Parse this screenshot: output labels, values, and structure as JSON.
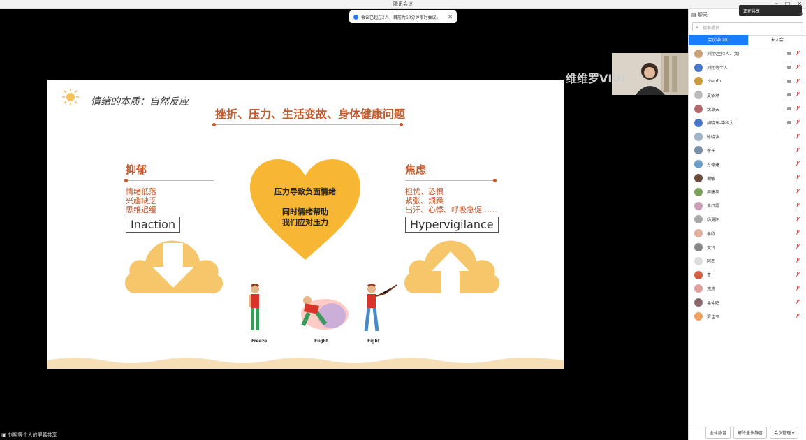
{
  "window": {
    "title": "腾讯会议",
    "controls": [
      "–",
      "□",
      "✕"
    ]
  },
  "notice": {
    "text": "会议已超过2人，目前为60分钟限时会议。",
    "close": "✕"
  },
  "slide": {
    "title": "情绪的本质：自然反应",
    "headline": "挫折、压力、生活变故、身体健康问题",
    "left": {
      "title": "抑郁",
      "items": [
        "情绪低落",
        "兴趣缺乏",
        "思维迟缓"
      ],
      "box": "Inaction"
    },
    "right": {
      "title": "焦虑",
      "items": [
        "担忧、恐惧",
        "紧张、烦躁",
        "出汗、心悸、呼吸急促……"
      ],
      "box": "Hypervigilance"
    },
    "heart": {
      "line1": "压力导致负面情绪",
      "line2": "同时情绪帮助",
      "line3": "我们应对压力"
    },
    "figures": [
      "Freeze",
      "Flight",
      "Fight"
    ],
    "colors": {
      "accent": "#c65a2e",
      "heart": "#f7b733",
      "cloud": "#f6c66a"
    }
  },
  "watermark": "维维罗VIVI",
  "status": {
    "sharing": "刘翔等个人的屏幕共享"
  },
  "panel": {
    "header": "聊天",
    "toast": "正在共享",
    "search_placeholder": "搜索成员",
    "tabs": [
      "会议中(20)",
      "未入会"
    ],
    "members": [
      {
        "name": "刘翔(主持人、我)",
        "sub": "(主持人、我)",
        "color": "#c9a27a",
        "mic": "muted-red"
      },
      {
        "name": "刘翔等个人",
        "sub": "",
        "color": "#4a78c8",
        "mic": "muted-red"
      },
      {
        "name": "zhenfu",
        "sub": "",
        "color": "#c99a3e",
        "mic": "muted-red"
      },
      {
        "name": "夏依然",
        "sub": "",
        "color": "#bbbbbb",
        "mic": "muted-red"
      },
      {
        "name": "沈卓天",
        "sub": "",
        "color": "#b46a6a",
        "mic": "muted-red"
      },
      {
        "name": "胡晓东-中科大",
        "sub": "",
        "color": "#4a78c8",
        "mic": "muted-red"
      },
      {
        "name": "陈晓波",
        "sub": "",
        "color": "#9fb4c7",
        "mic": "muted-red"
      },
      {
        "name": "徐长",
        "sub": "",
        "color": "#7a8fa6",
        "mic": "muted-red"
      },
      {
        "name": "方德建",
        "sub": "",
        "color": "#6fa0c8",
        "mic": "muted-red"
      },
      {
        "name": "谢敏",
        "sub": "",
        "color": "#6a4a3a",
        "mic": "muted-red"
      },
      {
        "name": "周建华",
        "sub": "",
        "color": "#7aa05a",
        "mic": "muted-red"
      },
      {
        "name": "黄红霞",
        "sub": "",
        "color": "#c8a0b8",
        "mic": "muted-red"
      },
      {
        "name": "杨夏阳",
        "sub": "",
        "color": "#aaaaaa",
        "mic": "muted-red"
      },
      {
        "name": "季欣",
        "sub": "",
        "color": "#e0b0a0",
        "mic": "muted-red"
      },
      {
        "name": "文玲",
        "sub": "",
        "color": "#888888",
        "mic": "muted-red"
      },
      {
        "name": "阿杰",
        "sub": "",
        "color": "#dddddd",
        "mic": "muted-red"
      },
      {
        "name": "青",
        "sub": "",
        "color": "#d06040",
        "mic": "muted-red"
      },
      {
        "name": "悠悠",
        "sub": "",
        "color": "#e0a0a0",
        "mic": "muted-red"
      },
      {
        "name": "易仲鸣",
        "sub": "",
        "color": "#8a6a6a",
        "mic": "muted-red"
      },
      {
        "name": "罗佳玉",
        "sub": "",
        "color": "#f0a060",
        "mic": "muted-red"
      }
    ],
    "footer": {
      "mute_all": "全体静音",
      "unmute_all": "解除全体静音",
      "manage": "会议管理 ▾"
    }
  }
}
